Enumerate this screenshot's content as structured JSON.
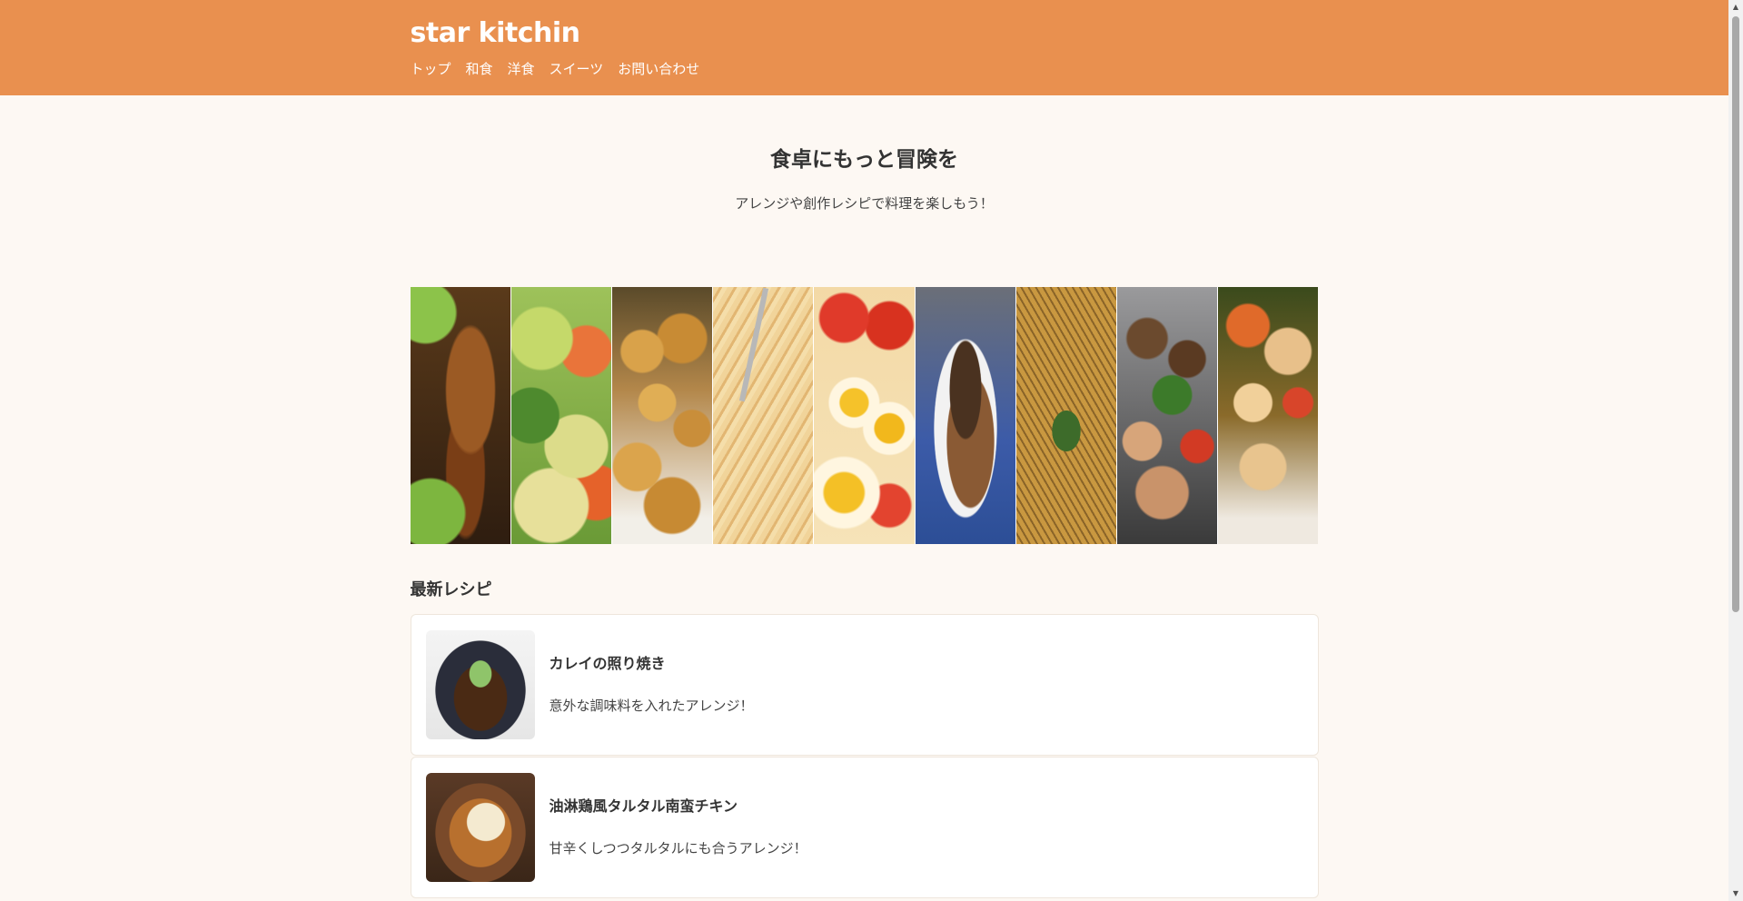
{
  "site": {
    "logo": "star kitchin",
    "nav": [
      "トップ",
      "和食",
      "洋食",
      "スイーツ",
      "お問い合わせ"
    ]
  },
  "hero": {
    "title": "食卓にもっと冒険を",
    "subtitle": "アレンジや創作レシピで料理を楽しもう！"
  },
  "banner": {
    "images": [
      "roast-chicken-photo",
      "steamed-vegetables-photo",
      "roasted-potatoes-photo",
      "pasta-fork-photo",
      "egg-tomato-pan-photo",
      "mushroom-grain-bowl-photo",
      "hasselback-potatoes-photo",
      "chicken-mushroom-stir-fry-photo",
      "chicken-skewers-photo"
    ]
  },
  "latest": {
    "heading": "最新レシピ",
    "recipes": [
      {
        "title": "カレイの照り焼き",
        "description": "意外な調味料を入れたアレンジ！",
        "image": "teriyaki-flounder-photo"
      },
      {
        "title": "油淋鶏風タルタル南蛮チキン",
        "description": "甘辛くしつつタルタルにも合うアレンジ！",
        "image": "tartar-nanban-chicken-photo"
      }
    ]
  },
  "colors": {
    "header": "#e9904f",
    "page_background": "#fdf8f3",
    "card_background": "#ffffff",
    "text": "#333333"
  }
}
